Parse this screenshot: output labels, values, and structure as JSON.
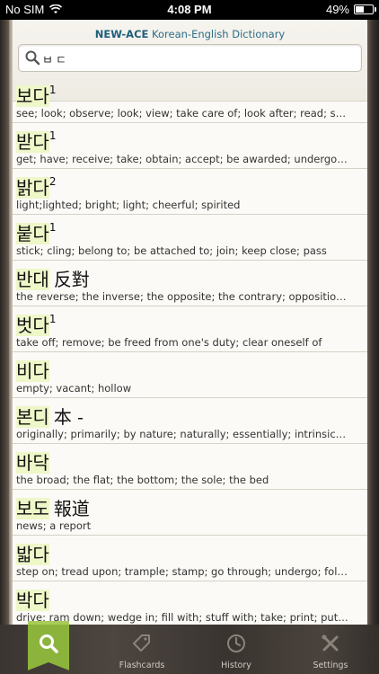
{
  "status_bar": {
    "carrier": "No SIM",
    "time": "4:08 PM",
    "battery_text": "49%",
    "battery_level": 0.49
  },
  "header": {
    "title_brand": "NEW-ACE",
    "title_rest": "Korean-English Dictionary"
  },
  "search": {
    "query": "ㅂㄷ"
  },
  "entries": [
    {
      "word": "보다",
      "sup": "1",
      "hanja": "",
      "gloss": "see; look; observe; look; view; take care of; look after; read; see; look thr..."
    },
    {
      "word": "받다",
      "sup": "1",
      "hanja": "",
      "gloss": "get; have; receive; take; obtain; accept; be awarded; undergo; go throug..."
    },
    {
      "word": "밝다",
      "sup": "2",
      "hanja": "",
      "gloss": "light;lighted; bright; light; cheerful; spirited"
    },
    {
      "word": "붙다",
      "sup": "1",
      "hanja": "",
      "gloss": "stick; cling; belong to; be attached to; join; keep close; pass"
    },
    {
      "word": "반대",
      "sup": "",
      "hanja": "反對",
      "gloss": "the reverse; the inverse; the opposite; the contrary; opposition; resistan..."
    },
    {
      "word": "벗다",
      "sup": "1",
      "hanja": "",
      "gloss": "take off; remove; be freed from one's duty; clear oneself of"
    },
    {
      "word": "비다",
      "sup": "",
      "hanja": "",
      "gloss": "empty; vacant; hollow"
    },
    {
      "word": "본디",
      "sup": "",
      "hanja": "本 -",
      "gloss": "originally; primarily; by nature; naturally; essentially; intrinsically"
    },
    {
      "word": "바닥",
      "sup": "",
      "hanja": "",
      "gloss": "the broad; the flat; the bottom; the sole; the bed"
    },
    {
      "word": "보도",
      "sup": "",
      "hanja": "報道",
      "gloss": "news; a report"
    },
    {
      "word": "밟다",
      "sup": "",
      "hanja": "",
      "gloss": "step on; tread upon; trample; stamp; go through; undergo; follow; track;..."
    },
    {
      "word": "박다",
      "sup": "",
      "hanja": "",
      "gloss": "drive; ram down; wedge in; fill with; stuff with; take; print; put in print; i..."
    }
  ],
  "tabs": {
    "search_icon": "magnifier-icon",
    "flashcards": "Flashcards",
    "history": "History",
    "settings": "Settings"
  },
  "colors": {
    "highlight": "#eef7c8",
    "title": "#2c6c86",
    "tab_active": "#8cb43c"
  }
}
